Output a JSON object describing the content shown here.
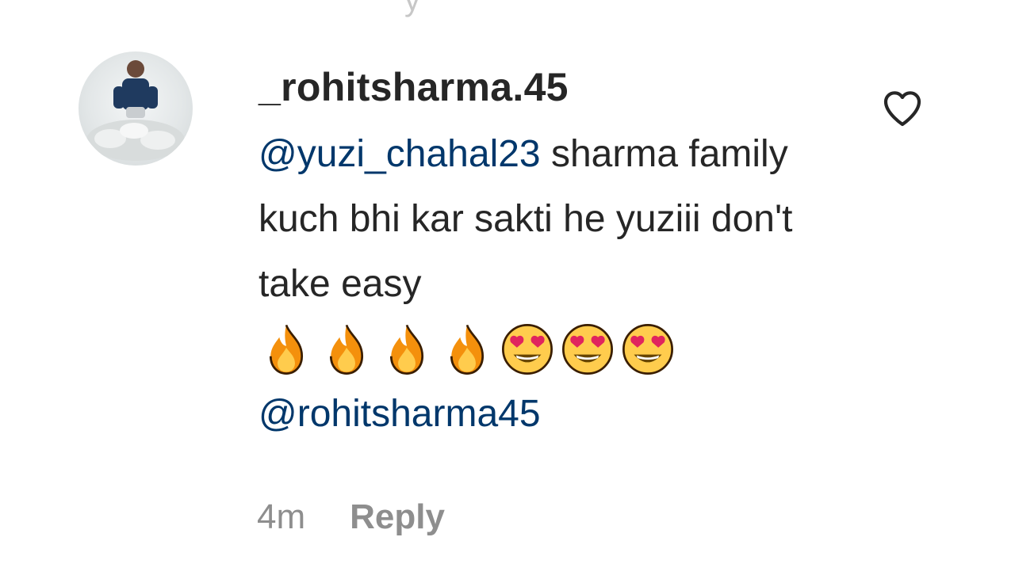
{
  "previous_comment": {
    "reply_stub": "y"
  },
  "comment": {
    "username": "_rohitsharma.45",
    "mention_1": "@yuzi_chahal23",
    "text_line": "sharma family kuch bhi kar sakti he yuziii don't take easy",
    "emojis": [
      "fire-emoji",
      "fire-emoji",
      "fire-emoji",
      "fire-emoji",
      "heart-eyes-emoji",
      "heart-eyes-emoji",
      "heart-eyes-emoji"
    ],
    "mention_2": "@rohitsharma45",
    "timestamp": "4m",
    "reply_label": "Reply"
  },
  "colors": {
    "text": "#262626",
    "mention": "#00376b",
    "secondary": "#8e8e8e"
  },
  "icons": {
    "like": "heart-outline-icon"
  }
}
